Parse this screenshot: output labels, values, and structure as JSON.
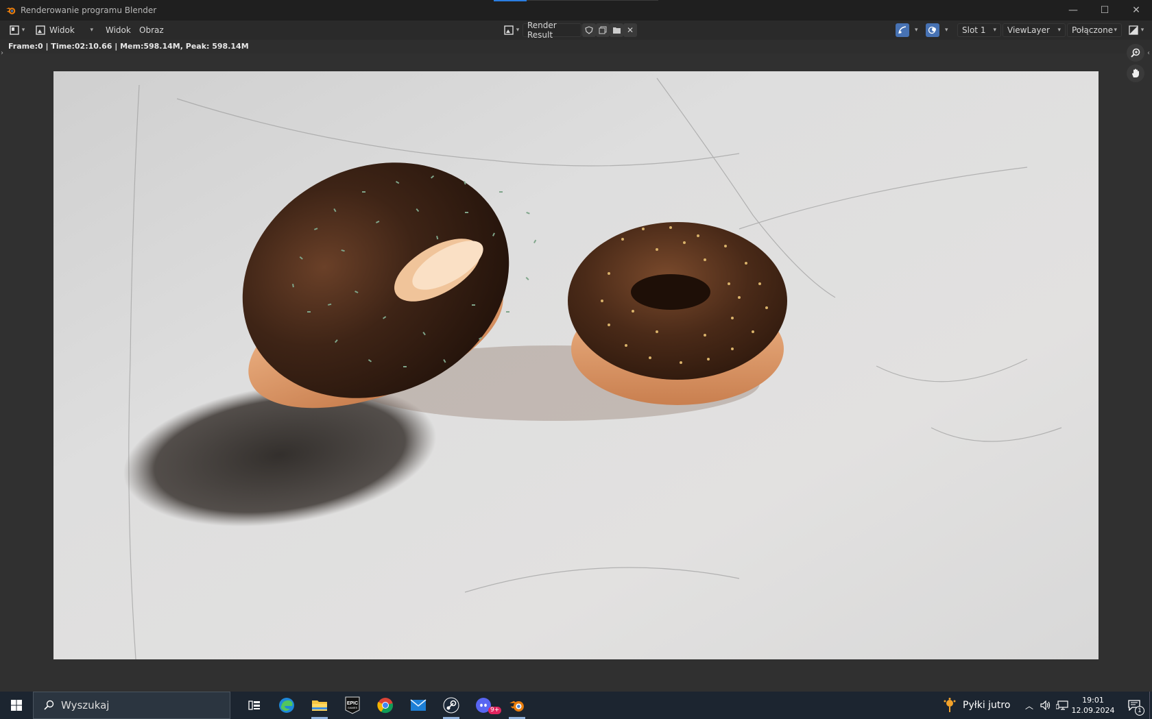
{
  "window": {
    "title": "Renderowanie programu Blender",
    "controls": {
      "minimize": "—",
      "maximize": "☐",
      "close": "✕"
    }
  },
  "toolbar": {
    "editor_type_icon": "image-editor-icon",
    "view_mode": "Widok",
    "menu_view": "Widok",
    "menu_image": "Obraz",
    "image_name": "Render Result",
    "slot": "Slot 1",
    "view_layer": "ViewLayer",
    "pass": "Połączone"
  },
  "status": {
    "text": "Frame:0 | Time:02:10.66 | Mem:598.14M, Peak: 598.14M"
  },
  "viewport": {
    "tools": [
      "zoom-icon",
      "hand-pan-icon"
    ]
  },
  "taskbar": {
    "search_placeholder": "Wyszukaj",
    "weather": "Pyłki jutro",
    "time": "19:01",
    "date": "12.09.2024",
    "notifications": "1",
    "discord_badge": "9+",
    "apps": [
      "task-view-icon",
      "edge-icon",
      "file-explorer-icon",
      "epic-games-icon",
      "chrome-icon",
      "mail-icon",
      "steam-icon",
      "discord-icon",
      "blender-icon"
    ]
  },
  "colors": {
    "blender_orange": "#e87d0d",
    "blender_blue": "#4772b3",
    "taskbar_bg": "#1c2530"
  }
}
